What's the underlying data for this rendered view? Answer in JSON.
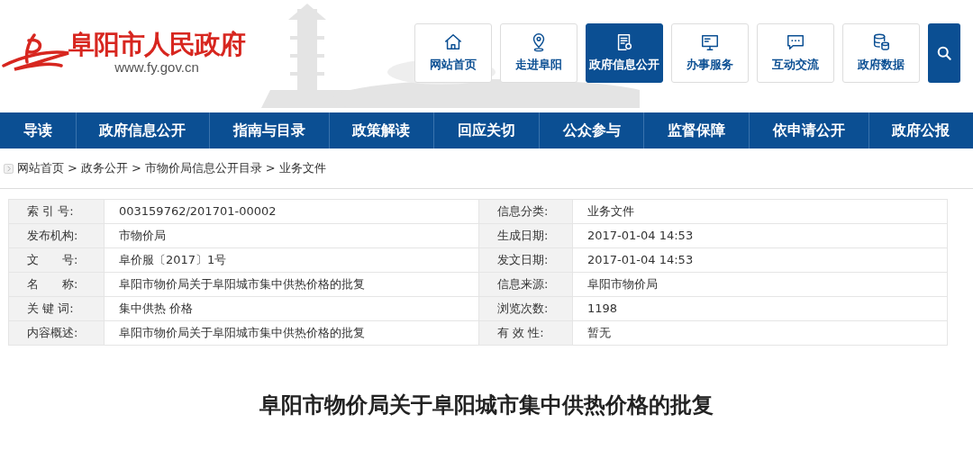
{
  "header": {
    "site_name": "阜阳市人民政府",
    "url": "www.fy.gov.cn"
  },
  "top_buttons": [
    {
      "label": "网站首页",
      "selected": false
    },
    {
      "label": "走进阜阳",
      "selected": false
    },
    {
      "label": "政府信息公开",
      "selected": true
    },
    {
      "label": "办事服务",
      "selected": false
    },
    {
      "label": "互动交流",
      "selected": false
    },
    {
      "label": "政府数据",
      "selected": false
    }
  ],
  "nav": [
    "导读",
    "政府信息公开",
    "指南与目录",
    "政策解读",
    "回应关切",
    "公众参与",
    "监督保障",
    "依申请公开",
    "政府公报"
  ],
  "breadcrumb": [
    "网站首页",
    "政务公开",
    "市物价局信息公开目录",
    "业务文件"
  ],
  "breadcrumb_separator": ">",
  "info_table": [
    {
      "label_1": "索 引 号:",
      "value_1": "003159762/201701-00002",
      "label_2": "信息分类:",
      "value_2": "业务文件"
    },
    {
      "label_1": "发布机构:",
      "value_1": "市物价局",
      "label_2": "生成日期:",
      "value_2": "2017-01-04 14:53"
    },
    {
      "label_1": "文　　号:",
      "value_1": "阜价服〔2017〕1号",
      "label_2": "发文日期:",
      "value_2": "2017-01-04 14:53"
    },
    {
      "label_1": "名　　称:",
      "value_1": "阜阳市物价局关于阜阳城市集中供热价格的批复",
      "label_2": "信息来源:",
      "value_2": "阜阳市物价局"
    },
    {
      "label_1": "关 键 词:",
      "value_1": "集中供热 价格",
      "label_2": "浏览次数:",
      "value_2": "1198"
    },
    {
      "label_1": "内容概述:",
      "value_1": "阜阳市物价局关于阜阳城市集中供热价格的批复",
      "label_2": "有 效 性:",
      "value_2": "暂无"
    }
  ],
  "article_title": "阜阳市物价局关于阜阳城市集中供热价格的批复"
}
